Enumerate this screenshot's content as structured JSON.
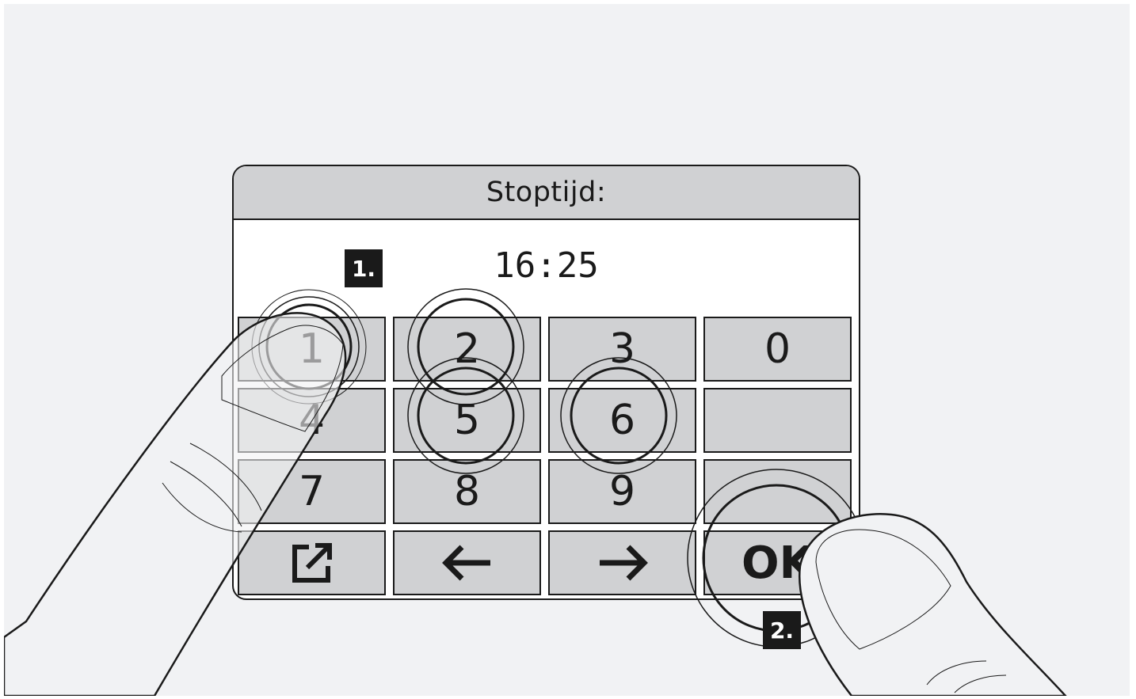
{
  "screen": {
    "title": "Stoptijd:",
    "value": "16:25"
  },
  "keypad": {
    "keys": [
      {
        "label": "1",
        "name": "key-1"
      },
      {
        "label": "2",
        "name": "key-2"
      },
      {
        "label": "3",
        "name": "key-3"
      },
      {
        "label": "0",
        "name": "key-0"
      },
      {
        "label": "4",
        "name": "key-4"
      },
      {
        "label": "5",
        "name": "key-5"
      },
      {
        "label": "6",
        "name": "key-6"
      },
      {
        "label": "",
        "name": "key-blank-1"
      },
      {
        "label": "7",
        "name": "key-7"
      },
      {
        "label": "8",
        "name": "key-8"
      },
      {
        "label": "9",
        "name": "key-9"
      },
      {
        "label": "",
        "name": "key-blank-2"
      },
      {
        "label": "",
        "name": "key-exit",
        "icon": "exit-icon"
      },
      {
        "label": "",
        "name": "key-left",
        "icon": "arrow-left-icon"
      },
      {
        "label": "",
        "name": "key-right",
        "icon": "arrow-right-icon"
      },
      {
        "label": "OK",
        "name": "key-ok"
      }
    ]
  },
  "steps": {
    "step1": "1.",
    "step2": "2."
  },
  "colors": {
    "background": "#f1f2f4",
    "key_fill": "#d0d1d3",
    "outline": "#1a1a1a",
    "badge": "#1a1a1a"
  }
}
